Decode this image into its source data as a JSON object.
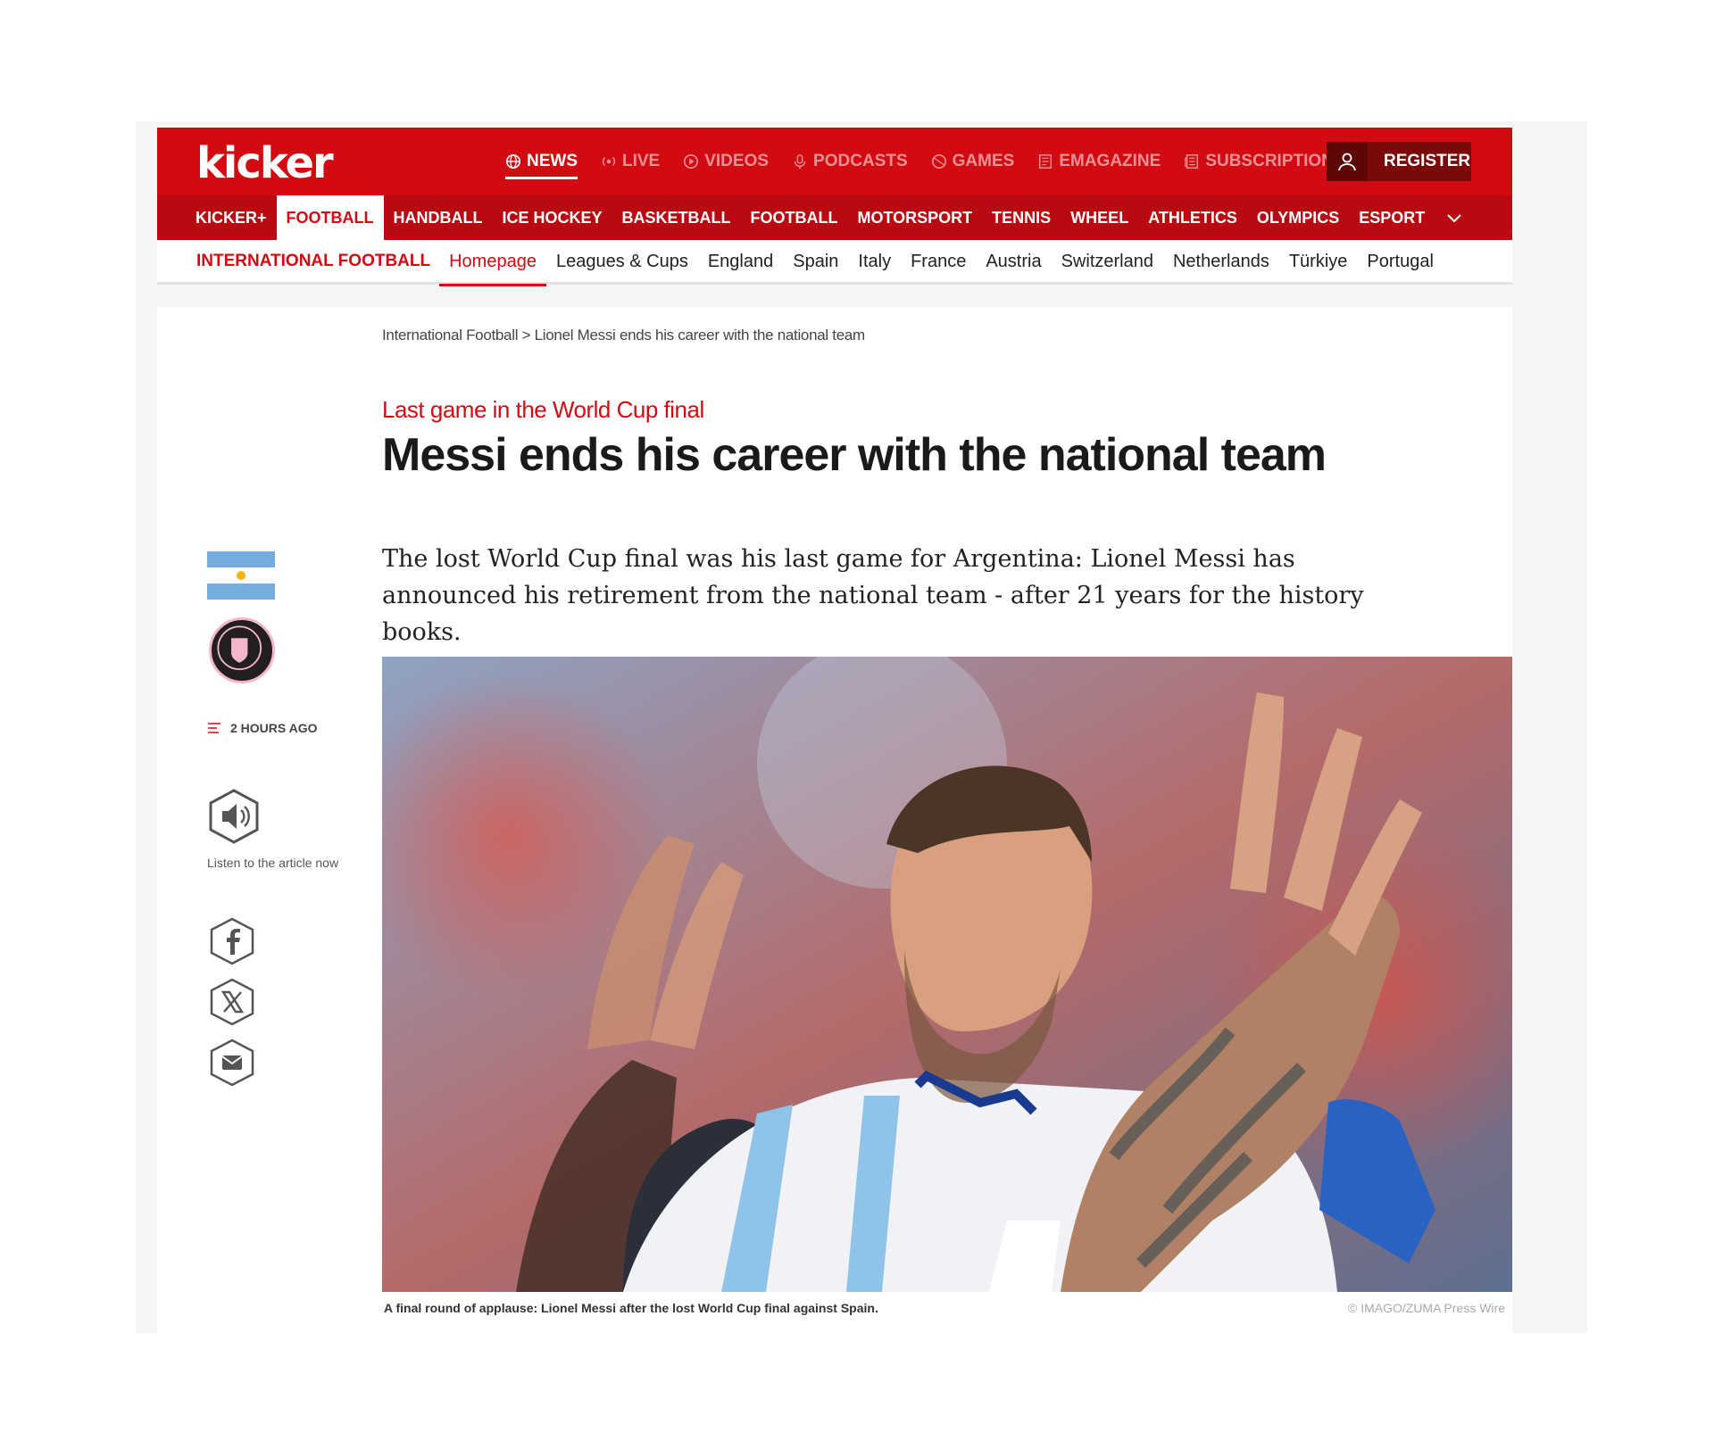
{
  "header": {
    "logo": "kicker",
    "main_nav": [
      {
        "label": "NEWS",
        "icon": "globe-icon",
        "active": true
      },
      {
        "label": "LIVE",
        "icon": "live-icon"
      },
      {
        "label": "VIDEOS",
        "icon": "play-icon"
      },
      {
        "label": "PODCASTS",
        "icon": "microphone-icon"
      },
      {
        "label": "GAMES",
        "icon": "ball-icon"
      },
      {
        "label": "EMAGAZINE",
        "icon": "magazine-icon"
      },
      {
        "label": "SUBSCRIPTION",
        "icon": "newspaper-icon"
      }
    ],
    "register_label": "REGISTER"
  },
  "sport_nav": [
    "KICKER+",
    "FOOTBALL",
    "HANDBALL",
    "ICE HOCKEY",
    "BASKETBALL",
    "FOOTBALL",
    "MOTORSPORT",
    "TENNIS",
    "WHEEL",
    "ATHLETICS",
    "OLYMPICS",
    "ESPORT"
  ],
  "sub_nav": {
    "title": "INTERNATIONAL FOOTBALL",
    "items": [
      "Homepage",
      "Leagues & Cups",
      "England",
      "Spain",
      "Italy",
      "France",
      "Austria",
      "Switzerland",
      "Netherlands",
      "Türkiye",
      "Portugal"
    ]
  },
  "article": {
    "breadcrumb": "International Football > Lionel Messi ends his career with the national team",
    "kicker": "Last game in the World Cup final",
    "headline": "Messi ends his career with the national team",
    "lead": "The lost World Cup final was his last game for Argentina: Lionel Messi has announced his retirement from the national team - after 21 years for the history books.",
    "time_ago": "2 HOURS AGO",
    "listen_label": "Listen to the article now",
    "caption": "A final round of applause: Lionel Messi after the lost World Cup final against Spain.",
    "credit": "© IMAGO/ZUMA Press Wire"
  },
  "colors": {
    "brand_red": "#d20a11",
    "dark_red": "#b80a10",
    "register_bg": "#7a0a0a"
  }
}
